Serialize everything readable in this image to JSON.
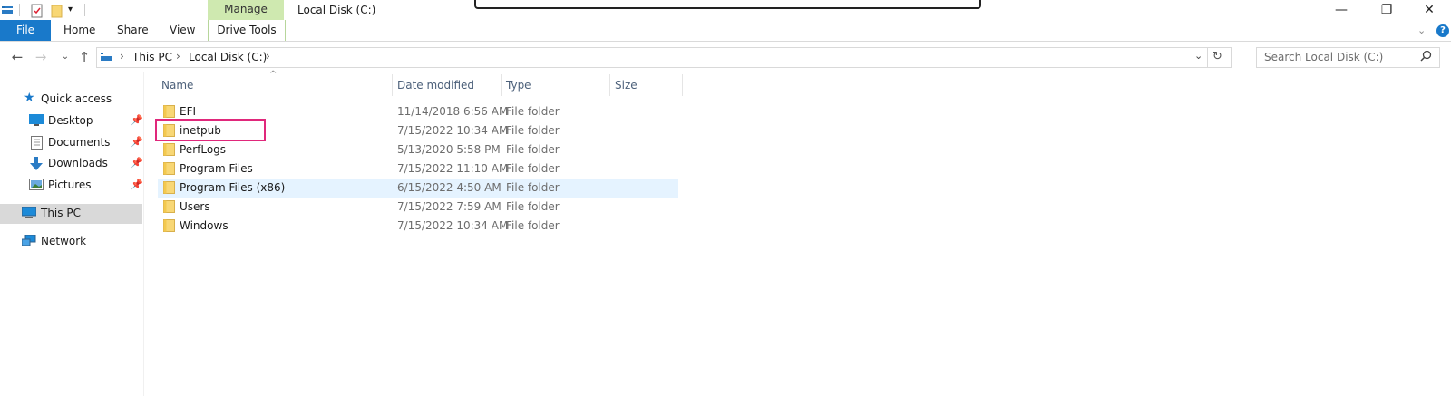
{
  "window": {
    "title": "Local Disk (C:)",
    "controls": {
      "minimize": "—",
      "restore": "❐",
      "close": "✕"
    }
  },
  "ribbon": {
    "context_group": "Manage",
    "tabs": [
      "File",
      "Home",
      "Share",
      "View",
      "Drive Tools"
    ],
    "help": "?"
  },
  "address_bar": {
    "breadcrumb": [
      "This PC",
      "Local Disk (C:)"
    ]
  },
  "search": {
    "placeholder": "Search Local Disk (C:)"
  },
  "nav_pane": {
    "quick_access": "Quick access",
    "quick_items": [
      {
        "label": "Desktop",
        "icon": "desktop-icon",
        "pinned": true
      },
      {
        "label": "Documents",
        "icon": "documents-icon",
        "pinned": true
      },
      {
        "label": "Downloads",
        "icon": "downloads-icon",
        "pinned": true
      },
      {
        "label": "Pictures",
        "icon": "pictures-icon",
        "pinned": true
      }
    ],
    "this_pc": "This PC",
    "network": "Network"
  },
  "file_list": {
    "columns": [
      "Name",
      "Date modified",
      "Type",
      "Size"
    ],
    "rows": [
      {
        "name": "EFI",
        "date": "11/14/2018 6:56 AM",
        "type": "File folder",
        "size": ""
      },
      {
        "name": "inetpub",
        "date": "7/15/2022 10:34 AM",
        "type": "File folder",
        "size": ""
      },
      {
        "name": "PerfLogs",
        "date": "5/13/2020 5:58 PM",
        "type": "File folder",
        "size": ""
      },
      {
        "name": "Program Files",
        "date": "7/15/2022 11:10 AM",
        "type": "File folder",
        "size": ""
      },
      {
        "name": "Program Files (x86)",
        "date": "6/15/2022 4:50 AM",
        "type": "File folder",
        "size": ""
      },
      {
        "name": "Users",
        "date": "7/15/2022 7:59 AM",
        "type": "File folder",
        "size": ""
      },
      {
        "name": "Windows",
        "date": "7/15/2022 10:34 AM",
        "type": "File folder",
        "size": ""
      }
    ]
  },
  "colors": {
    "file_tab": "#1979ca",
    "manage_tab": "#cfe9b0",
    "highlight": "#e0287b",
    "selected_row": "#e5f3ff",
    "nav_selected": "#d9d9d9"
  }
}
